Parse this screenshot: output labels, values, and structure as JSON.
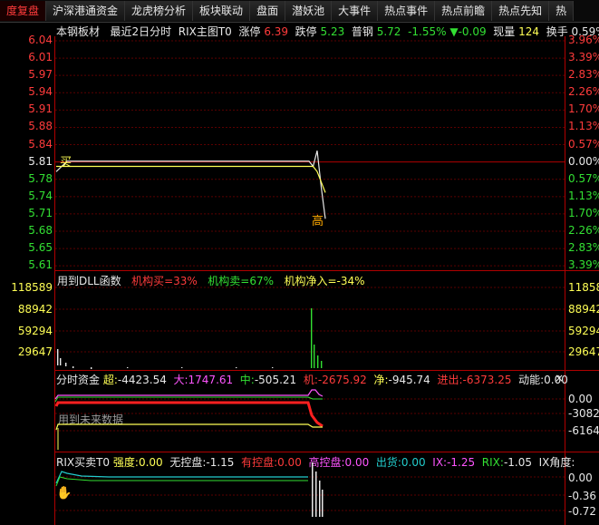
{
  "tabs": [
    {
      "label": "度复盘",
      "active": true
    },
    {
      "label": "沪深港通资金",
      "active": false
    },
    {
      "label": "龙虎榜分析",
      "active": false
    },
    {
      "label": "板块联动",
      "active": false
    },
    {
      "label": "盘面",
      "active": false
    },
    {
      "label": "潜妖池",
      "active": false
    },
    {
      "label": "大事件",
      "active": false
    },
    {
      "label": "热点事件",
      "active": false
    },
    {
      "label": "热点前瞻",
      "active": false
    },
    {
      "label": "热点先知",
      "active": false
    },
    {
      "label": "热",
      "active": false
    }
  ],
  "header": {
    "stock": "本钢板材",
    "period": "最近2日分时",
    "indicator": "RIX主图T0",
    "zt_label": "涨停",
    "zt_value": "6.39",
    "dt_label": "跌停",
    "dt_value": "5.23",
    "ref_name": "普钢",
    "ref_price": "5.72",
    "ref_pct": "-1.55%",
    "ref_arrow": "▼",
    "ref_chg": "-0.09",
    "vol_label": "现量",
    "vol_value": "124",
    "turn_label": "换手",
    "turn_value": "0.59%"
  },
  "price_axis": {
    "left": [
      "6.04",
      "6.01",
      "5.97",
      "5.94",
      "5.91",
      "5.88",
      "5.84",
      "5.81",
      "5.78",
      "5.74",
      "5.71",
      "5.68",
      "5.65",
      "5.61"
    ],
    "right": [
      "3.96%",
      "3.39%",
      "2.83%",
      "2.26%",
      "1.70%",
      "1.13%",
      "0.57%",
      "0.00%",
      "0.57%",
      "1.13%",
      "1.70%",
      "2.26%",
      "2.83%",
      "3.39%"
    ]
  },
  "price_marks": {
    "buy": "买",
    "sell": "高"
  },
  "vol_panel": {
    "title": "用到DLL函数",
    "buy": "机构买=33%",
    "sell": "机构卖=67%",
    "net": "机构净入=-34%",
    "left_axis": [
      "118589",
      "88942",
      "59294",
      "29647"
    ],
    "right_axis": [
      "118589",
      "88942",
      "59294",
      "29647"
    ]
  },
  "fund_panel": {
    "title": "分时资金",
    "super_label": "超:",
    "super_value": "-4423.54",
    "big_label": "大:",
    "big_value": "1747.61",
    "mid_label": "中:",
    "mid_value": "-505.21",
    "inst_label": "机:",
    "inst_value": "-2675.92",
    "net_label": "净:",
    "net_value": "-945.74",
    "io_label": "进出:",
    "io_value": "-6373.25",
    "mom_label": "动能:",
    "mom_value": "0.00",
    "close": "×",
    "future": "用到未来数据",
    "right_axis": [
      "0.00",
      "-3082",
      "-6164"
    ]
  },
  "rix_panel": {
    "title": "RIX买卖T0",
    "strength_label": "强度:",
    "strength_value": "0.00",
    "nocontrol_label": "无控盘:",
    "nocontrol_value": "-1.15",
    "control_label": "有控盘:",
    "control_value": "0.00",
    "high_label": "高控盘:",
    "high_value": "0.00",
    "ship_label": "出货:",
    "ship_value": "0.00",
    "ix_label": "IX:",
    "ix_value": "-1.25",
    "rix_label": "RIX:",
    "rix_value": "-1.05",
    "angle_label": "IX角度:",
    "right_axis": [
      "0.00",
      "-0.36",
      "-0.72"
    ]
  },
  "chart_data": {
    "type": "line",
    "title": "本钢板材 最近2日分时",
    "price_ylim": [
      5.61,
      6.04
    ],
    "prev_close": 5.81,
    "series": [
      {
        "name": "price",
        "values": [
          5.79,
          5.81,
          5.81,
          5.81,
          5.81,
          5.81,
          5.81,
          5.81,
          5.81,
          5.81,
          5.81,
          5.81,
          5.81,
          5.81,
          5.81,
          5.81,
          5.81,
          5.81,
          5.81,
          5.81,
          5.81,
          5.81,
          5.81,
          5.81,
          5.8,
          5.83,
          5.76,
          5.7
        ]
      },
      {
        "name": "avg",
        "values": [
          5.8,
          5.8,
          5.8,
          5.8,
          5.8,
          5.8,
          5.8,
          5.8,
          5.8,
          5.8,
          5.8,
          5.8,
          5.8,
          5.8,
          5.8,
          5.8,
          5.8,
          5.8,
          5.8,
          5.8,
          5.8,
          5.8,
          5.8,
          5.8,
          5.8,
          5.79,
          5.77,
          5.75
        ]
      }
    ]
  },
  "colors": {
    "up": "#ff3b3b",
    "down": "#33e033",
    "grid": "#7a0000",
    "price": "#e8e8e8",
    "avg": "#ffff55"
  }
}
